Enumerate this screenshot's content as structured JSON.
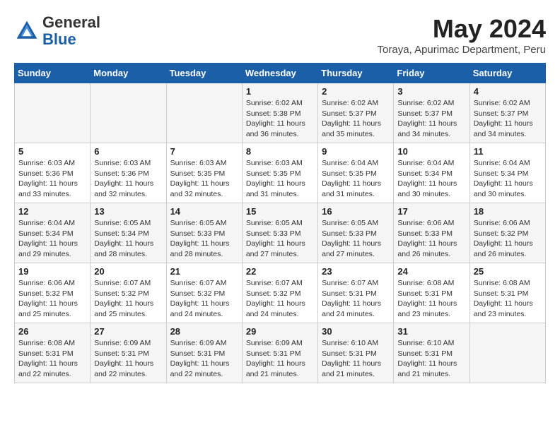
{
  "header": {
    "logo_general": "General",
    "logo_blue": "Blue",
    "month_year": "May 2024",
    "location": "Toraya, Apurimac Department, Peru"
  },
  "days_of_week": [
    "Sunday",
    "Monday",
    "Tuesday",
    "Wednesday",
    "Thursday",
    "Friday",
    "Saturday"
  ],
  "weeks": [
    [
      {
        "day": "",
        "info": ""
      },
      {
        "day": "",
        "info": ""
      },
      {
        "day": "",
        "info": ""
      },
      {
        "day": "1",
        "info": "Sunrise: 6:02 AM\nSunset: 5:38 PM\nDaylight: 11 hours and 36 minutes."
      },
      {
        "day": "2",
        "info": "Sunrise: 6:02 AM\nSunset: 5:37 PM\nDaylight: 11 hours and 35 minutes."
      },
      {
        "day": "3",
        "info": "Sunrise: 6:02 AM\nSunset: 5:37 PM\nDaylight: 11 hours and 34 minutes."
      },
      {
        "day": "4",
        "info": "Sunrise: 6:02 AM\nSunset: 5:37 PM\nDaylight: 11 hours and 34 minutes."
      }
    ],
    [
      {
        "day": "5",
        "info": "Sunrise: 6:03 AM\nSunset: 5:36 PM\nDaylight: 11 hours and 33 minutes."
      },
      {
        "day": "6",
        "info": "Sunrise: 6:03 AM\nSunset: 5:36 PM\nDaylight: 11 hours and 32 minutes."
      },
      {
        "day": "7",
        "info": "Sunrise: 6:03 AM\nSunset: 5:35 PM\nDaylight: 11 hours and 32 minutes."
      },
      {
        "day": "8",
        "info": "Sunrise: 6:03 AM\nSunset: 5:35 PM\nDaylight: 11 hours and 31 minutes."
      },
      {
        "day": "9",
        "info": "Sunrise: 6:04 AM\nSunset: 5:35 PM\nDaylight: 11 hours and 31 minutes."
      },
      {
        "day": "10",
        "info": "Sunrise: 6:04 AM\nSunset: 5:34 PM\nDaylight: 11 hours and 30 minutes."
      },
      {
        "day": "11",
        "info": "Sunrise: 6:04 AM\nSunset: 5:34 PM\nDaylight: 11 hours and 30 minutes."
      }
    ],
    [
      {
        "day": "12",
        "info": "Sunrise: 6:04 AM\nSunset: 5:34 PM\nDaylight: 11 hours and 29 minutes."
      },
      {
        "day": "13",
        "info": "Sunrise: 6:05 AM\nSunset: 5:34 PM\nDaylight: 11 hours and 28 minutes."
      },
      {
        "day": "14",
        "info": "Sunrise: 6:05 AM\nSunset: 5:33 PM\nDaylight: 11 hours and 28 minutes."
      },
      {
        "day": "15",
        "info": "Sunrise: 6:05 AM\nSunset: 5:33 PM\nDaylight: 11 hours and 27 minutes."
      },
      {
        "day": "16",
        "info": "Sunrise: 6:05 AM\nSunset: 5:33 PM\nDaylight: 11 hours and 27 minutes."
      },
      {
        "day": "17",
        "info": "Sunrise: 6:06 AM\nSunset: 5:33 PM\nDaylight: 11 hours and 26 minutes."
      },
      {
        "day": "18",
        "info": "Sunrise: 6:06 AM\nSunset: 5:32 PM\nDaylight: 11 hours and 26 minutes."
      }
    ],
    [
      {
        "day": "19",
        "info": "Sunrise: 6:06 AM\nSunset: 5:32 PM\nDaylight: 11 hours and 25 minutes."
      },
      {
        "day": "20",
        "info": "Sunrise: 6:07 AM\nSunset: 5:32 PM\nDaylight: 11 hours and 25 minutes."
      },
      {
        "day": "21",
        "info": "Sunrise: 6:07 AM\nSunset: 5:32 PM\nDaylight: 11 hours and 24 minutes."
      },
      {
        "day": "22",
        "info": "Sunrise: 6:07 AM\nSunset: 5:32 PM\nDaylight: 11 hours and 24 minutes."
      },
      {
        "day": "23",
        "info": "Sunrise: 6:07 AM\nSunset: 5:31 PM\nDaylight: 11 hours and 24 minutes."
      },
      {
        "day": "24",
        "info": "Sunrise: 6:08 AM\nSunset: 5:31 PM\nDaylight: 11 hours and 23 minutes."
      },
      {
        "day": "25",
        "info": "Sunrise: 6:08 AM\nSunset: 5:31 PM\nDaylight: 11 hours and 23 minutes."
      }
    ],
    [
      {
        "day": "26",
        "info": "Sunrise: 6:08 AM\nSunset: 5:31 PM\nDaylight: 11 hours and 22 minutes."
      },
      {
        "day": "27",
        "info": "Sunrise: 6:09 AM\nSunset: 5:31 PM\nDaylight: 11 hours and 22 minutes."
      },
      {
        "day": "28",
        "info": "Sunrise: 6:09 AM\nSunset: 5:31 PM\nDaylight: 11 hours and 22 minutes."
      },
      {
        "day": "29",
        "info": "Sunrise: 6:09 AM\nSunset: 5:31 PM\nDaylight: 11 hours and 21 minutes."
      },
      {
        "day": "30",
        "info": "Sunrise: 6:10 AM\nSunset: 5:31 PM\nDaylight: 11 hours and 21 minutes."
      },
      {
        "day": "31",
        "info": "Sunrise: 6:10 AM\nSunset: 5:31 PM\nDaylight: 11 hours and 21 minutes."
      },
      {
        "day": "",
        "info": ""
      }
    ]
  ]
}
